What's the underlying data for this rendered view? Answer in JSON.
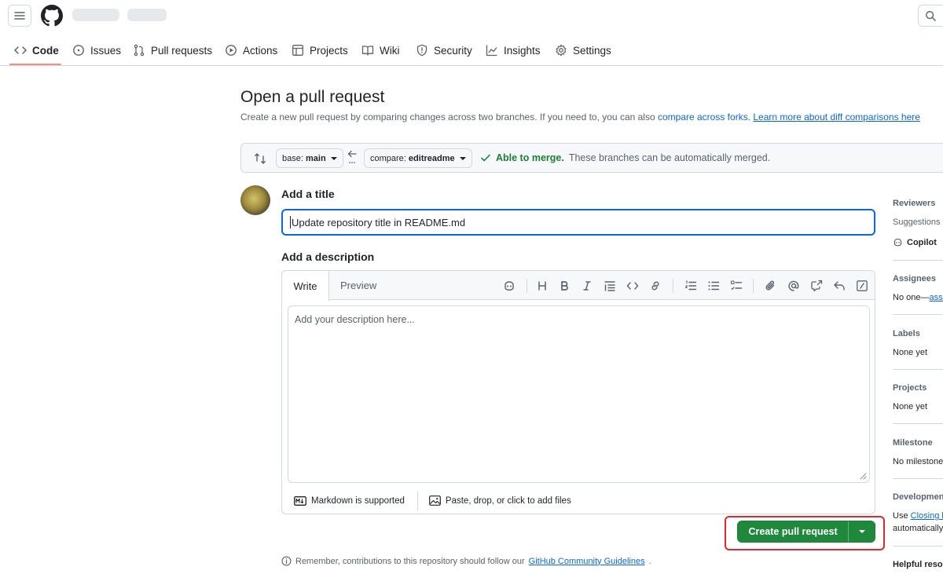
{
  "header": {
    "menu_icon": "hamburger-icon",
    "logo_icon": "github-logo-icon",
    "search_icon": "search-icon"
  },
  "nav": {
    "items": [
      {
        "label": "Code",
        "icon": "code-icon",
        "active": true
      },
      {
        "label": "Issues",
        "icon": "issue-icon"
      },
      {
        "label": "Pull requests",
        "icon": "pull-request-icon"
      },
      {
        "label": "Actions",
        "icon": "play-icon"
      },
      {
        "label": "Projects",
        "icon": "table-icon"
      },
      {
        "label": "Wiki",
        "icon": "book-icon"
      },
      {
        "label": "Security",
        "icon": "shield-icon"
      },
      {
        "label": "Insights",
        "icon": "graph-icon"
      },
      {
        "label": "Settings",
        "icon": "gear-icon"
      }
    ]
  },
  "page": {
    "title": "Open a pull request",
    "subtitle_prefix": "Create a new pull request by comparing changes across two branches. If you need to, you can also",
    "compare_forks_link": "compare across forks.",
    "learn_more_link": "Learn more about diff comparisons here"
  },
  "branches": {
    "base_label": "base:",
    "base_value": "main",
    "compare_label": "compare:",
    "compare_value": "editreadme",
    "merge_status": "Able to merge.",
    "merge_detail": "These branches can be automatically merged."
  },
  "form": {
    "title_label": "Add a title",
    "title_value": "Update repository title in README.md",
    "description_label": "Add a description",
    "tab_write": "Write",
    "tab_preview": "Preview",
    "description_placeholder": "Add your description here...",
    "markdown_note": "Markdown is supported",
    "attach_note": "Paste, drop, or click to add files",
    "toolbar_icons": [
      "copilot-icon",
      "heading-icon",
      "bold-icon",
      "italic-icon",
      "quote-icon",
      "code-icon",
      "link-icon",
      "ordered-list-icon",
      "unordered-list-icon",
      "task-list-icon",
      "attachment-icon",
      "mention-icon",
      "cross-reference-icon",
      "reply-icon",
      "slash-command-icon"
    ]
  },
  "actions": {
    "create_label": "Create pull request",
    "remember_prefix": "Remember, contributions to this repository should follow our",
    "guidelines_link": "GitHub Community Guidelines",
    "remember_suffix": "."
  },
  "sidebar": {
    "reviewers_h": "Reviewers",
    "suggestions": "Suggestions",
    "copilot": "Copilot",
    "assignees_h": "Assignees",
    "assignees_v": "No one—",
    "assignees_link": "assign yourself",
    "labels_h": "Labels",
    "labels_v": "None yet",
    "projects_h": "Projects",
    "projects_v": "None yet",
    "milestone_h": "Milestone",
    "milestone_v": "No milestone",
    "development_h": "Development",
    "development_use": "Use",
    "development_link": "Closing keywords",
    "development_v": "automatically",
    "helpful_h": "Helpful resources"
  },
  "colors": {
    "accent": "#0969da",
    "primary_green": "#1f883d",
    "success_text": "#1a7f37",
    "highlight_red": "#e5262a",
    "nav_underline": "#fd8c73"
  }
}
